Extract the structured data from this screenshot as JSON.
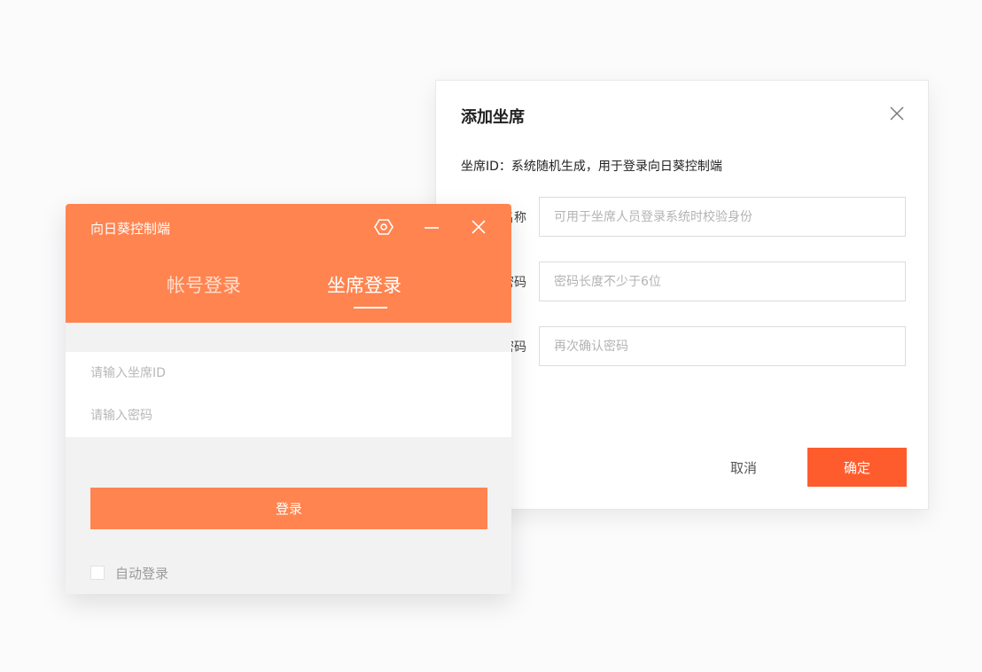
{
  "add_seat_dialog": {
    "title": "添加坐席",
    "description": "坐席ID：系统随机生成，用于登录向日葵控制端",
    "fields": [
      {
        "label": "坐席名称：",
        "placeholder": "可用于坐席人员登录系统时校验身份"
      },
      {
        "label": "密码：",
        "placeholder": "密码长度不少于6位"
      },
      {
        "label": "确认密码：",
        "placeholder": "再次确认密码"
      }
    ],
    "cancel_label": "取消",
    "confirm_label": "确定",
    "close_icon": "close-icon"
  },
  "login_window": {
    "app_title": "向日葵控制端",
    "settings_icon": "hexagon-settings-icon",
    "minimize_icon": "minimize-icon",
    "close_icon": "close-icon",
    "tabs": [
      {
        "label": "帐号登录",
        "active": false
      },
      {
        "label": "坐席登录",
        "active": true
      }
    ],
    "seat_id_placeholder": "请输入坐席ID",
    "password_placeholder": "请输入密码",
    "login_label": "登录",
    "auto_login_label": "自动登录",
    "auto_login_checked": false
  },
  "colors": {
    "brand_orange": "#ff8450",
    "confirm_orange": "#ff5c2e"
  }
}
